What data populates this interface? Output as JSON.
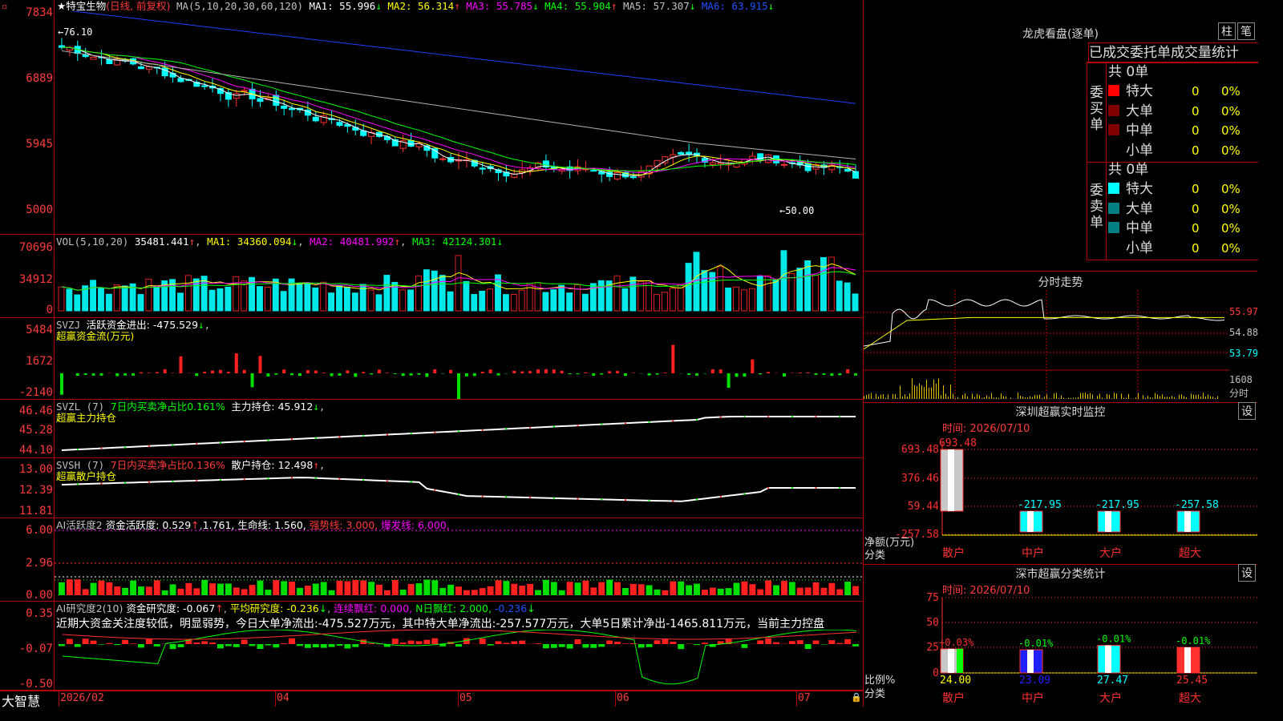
{
  "app": {
    "logo": "大智慧"
  },
  "stock": {
    "prefix": "★",
    "name": "特宝生物",
    "mode": "(日线, 前复权)"
  },
  "kline": {
    "ma_params": "MA(5,10,20,30,60,120)",
    "ma": [
      {
        "label": "MA1: 55.996",
        "arrow": "↓",
        "color": "#ffffff"
      },
      {
        "label": "MA2: 56.314",
        "arrow": "↑",
        "color": "#ffff00"
      },
      {
        "label": "MA3: 55.785",
        "arrow": "↓",
        "color": "#ff00ff"
      },
      {
        "label": "MA4: 55.904",
        "arrow": "↑",
        "color": "#00ff00"
      },
      {
        "label": "MA5: 57.307",
        "arrow": "↓",
        "color": "#c0c0c0"
      },
      {
        "label": "MA6: 63.915",
        "arrow": "↓",
        "color": "#2050ff"
      }
    ],
    "y_ticks": [
      "7834",
      "6889",
      "5945",
      "5000"
    ],
    "high_label": "76.10",
    "low_label": "←50.00"
  },
  "vol": {
    "title": "VOL(5,10,20)",
    "value": "35481.441",
    "arrow": "↑",
    "ma1": "MA1: 34360.094",
    "ma1_arrow": "↓",
    "ma2": "MA2: 40481.992",
    "ma2_arrow": "↑",
    "ma3": "MA3: 42124.301",
    "ma3_arrow": "↓",
    "y_ticks": [
      "70696",
      "34912",
      "0"
    ]
  },
  "svzj": {
    "title": "SVZJ",
    "field": "活跃资金进出: -475.529",
    "arrow": "↓",
    "sub": "超赢资金流(万元)",
    "y_ticks": [
      "5484",
      "1672",
      "-2140"
    ]
  },
  "svzl": {
    "title": "SVZL (7)",
    "ratio": "7日内买卖净占比0.161%",
    "field": "主力持仓: 45.912",
    "arrow": "↓",
    "sub": "超赢主力持仓",
    "y_ticks": [
      "46.46",
      "45.28",
      "44.10"
    ]
  },
  "svsh": {
    "title": "SVSH (7)",
    "ratio": "7日内买卖净占比0.136%",
    "field": "散户持仓: 12.498",
    "arrow": "↑",
    "sub": "超赢散户持仓",
    "y_ticks": [
      "13.00",
      "12.39",
      "11.81"
    ]
  },
  "ai1": {
    "title": "AI活跃度2",
    "f1": "资金活跃度: 0.529",
    "a1": "↑",
    "f2": "1.761,",
    "f3": "生命线: 1.560,",
    "f4": "强势线: 3.000,",
    "f5": "爆发线: 6.000,",
    "y_ticks": [
      "6.00",
      "2.96",
      "0.00"
    ]
  },
  "ai2": {
    "title": "AI研究度2(10)",
    "f1": "资金研究度: -0.067",
    "a1": "↑",
    "f2": "平均研究度: -0.236",
    "a2": "↓",
    "f3": "连续飘红: 0.000,",
    "f4": "N日飘红: 2.000,",
    "f5": "-0.236",
    "a5": "↓",
    "text": "近期大资金关注度较低，明显弱势，今日大单净流出:-475.527万元，其中特大单净流出:-257.577万元，大单5日累计净出-1465.811万元，当前主力控盘",
    "y_ticks": [
      "0.35",
      "-0.07",
      "-0.50"
    ]
  },
  "xaxis": [
    "2026/02",
    "04",
    "05",
    "06",
    "07"
  ],
  "dragon": {
    "title": "龙虎看盘(逐单)",
    "btn1": "柱",
    "btn2": "笔",
    "header": "已成交委托单成交量统计",
    "buy": {
      "side": "委买单",
      "total": "共 0单",
      "rows": [
        {
          "label": "特大",
          "count": "0",
          "pct": "0%",
          "color": "#ff0000"
        },
        {
          "label": "大单",
          "count": "0",
          "pct": "0%",
          "color": "#800000"
        },
        {
          "label": "中单",
          "count": "0",
          "pct": "0%",
          "color": "#800000"
        },
        {
          "label": "小单",
          "count": "0",
          "pct": "0%",
          "color": "#000000"
        }
      ]
    },
    "sell": {
      "side": "委卖单",
      "total": "共 0单",
      "rows": [
        {
          "label": "特大",
          "count": "0",
          "pct": "0%",
          "color": "#00ffff"
        },
        {
          "label": "大单",
          "count": "0",
          "pct": "0%",
          "color": "#008080"
        },
        {
          "label": "中单",
          "count": "0",
          "pct": "0%",
          "color": "#008080"
        },
        {
          "label": "小单",
          "count": "0",
          "pct": "0%",
          "color": "#000000"
        }
      ]
    }
  },
  "intraday": {
    "title": "分时走势",
    "prices": [
      "55.97",
      "54.88",
      "53.79"
    ],
    "vol": "1608",
    "vol_label": "分时"
  },
  "monitor": {
    "title": "深圳超赢实时监控",
    "btn": "设",
    "time": "时间: 2026/07/10",
    "y_ticks": [
      "693.48",
      "376.46",
      "59.44",
      "-257.58"
    ],
    "ylabel": "净额(万元)",
    "xlabel": "分类",
    "bars": [
      {
        "cat": "散户",
        "value": "693.48"
      },
      {
        "cat": "中户",
        "value": "-217.95"
      },
      {
        "cat": "大户",
        "value": "-217.95"
      },
      {
        "cat": "超大",
        "value": "-257.58"
      }
    ]
  },
  "classify": {
    "title": "深市超赢分类统计",
    "btn": "设",
    "time": "时间: 2026/07/10",
    "y_ticks": [
      "75",
      "50",
      "25",
      "0"
    ],
    "ylabel": "比例%",
    "xlabel": "分类",
    "bars": [
      {
        "cat": "散户",
        "value": "24.00",
        "delta": "+0.03%"
      },
      {
        "cat": "中户",
        "value": "23.09",
        "delta": "-0.01%"
      },
      {
        "cat": "大户",
        "value": "27.47",
        "delta": "-0.01%"
      },
      {
        "cat": "超大",
        "value": "25.45",
        "delta": "-0.01%"
      }
    ]
  }
}
